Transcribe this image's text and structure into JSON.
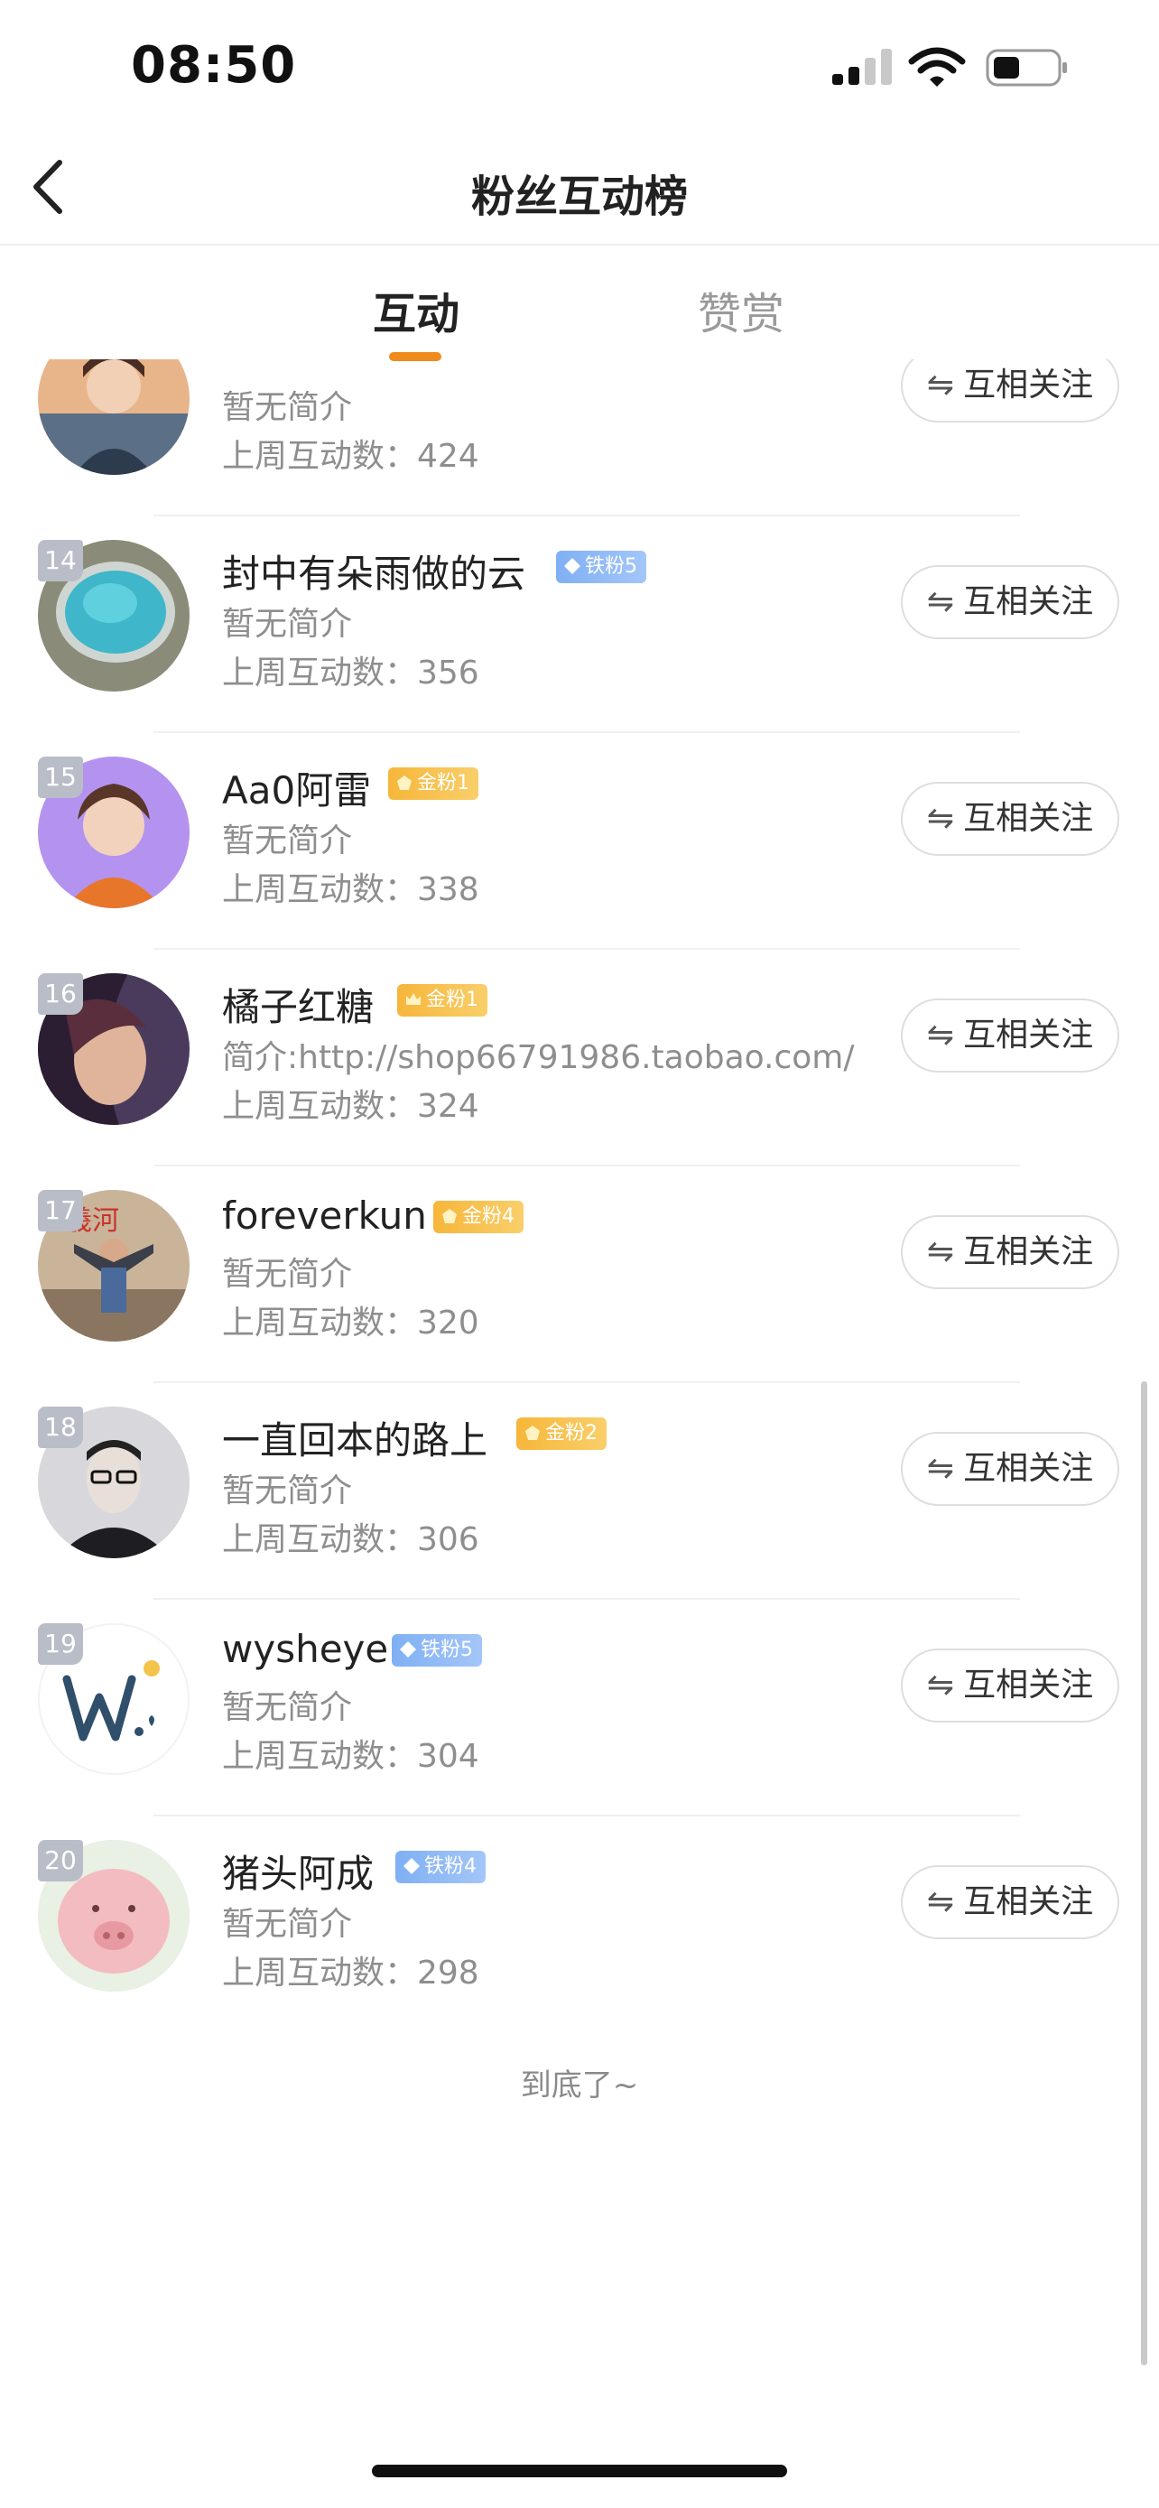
{
  "status_bar": {
    "time": "08:50"
  },
  "nav": {
    "title": "粉丝互动榜"
  },
  "tabs": [
    {
      "label": "互动",
      "active": true
    },
    {
      "label": "赞赏",
      "active": false
    }
  ],
  "rows": [
    {
      "rank": "",
      "name": "",
      "badge": "",
      "bio": "暂无简介",
      "count": "上周互动数：424",
      "button": "互相关注"
    },
    {
      "rank": "14",
      "name": "封中有朵雨做的云",
      "badge": "铁粉5",
      "bio": "暂无简介",
      "count": "上周互动数：356",
      "button": "互相关注"
    },
    {
      "rank": "15",
      "name": "Aa0阿雷",
      "badge": "金粉1",
      "bio": "暂无简介",
      "count": "上周互动数：338",
      "button": "互相关注"
    },
    {
      "rank": "16",
      "name": "橘子红糖",
      "badge": "金粉1",
      "bio": "简介:http://shop66791986.taobao.com/",
      "count": "上周互动数：324",
      "button": "互相关注"
    },
    {
      "rank": "17",
      "name": "foreverkun",
      "badge": "金粉4",
      "bio": "暂无简介",
      "count": "上周互动数：320",
      "button": "互相关注"
    },
    {
      "rank": "18",
      "name": "一直回本的路上",
      "badge": "金粉2",
      "bio": "暂无简介",
      "count": "上周互动数：306",
      "button": "互相关注"
    },
    {
      "rank": "19",
      "name": "wysheye",
      "badge": "铁粉5",
      "bio": "暂无简介",
      "count": "上周互动数：304",
      "button": "互相关注"
    },
    {
      "rank": "20",
      "name": "猪头阿成",
      "badge": "铁粉4",
      "bio": "暂无简介",
      "count": "上周互动数：298",
      "button": "互相关注"
    }
  ],
  "footer": {
    "end_text": "到底了~"
  },
  "colors": {
    "accent": "#f08a1c",
    "iron_badge": "#7fb0f4",
    "gold_badge": "#f6b63a",
    "rank_tag": "#b9bdc8"
  }
}
